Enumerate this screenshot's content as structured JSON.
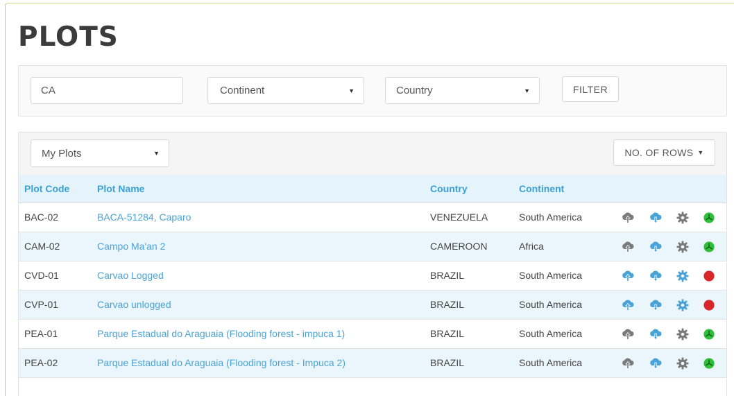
{
  "page": {
    "title": "PLOTS"
  },
  "filters": {
    "search_value": "CA",
    "continent_label": "Continent",
    "country_label": "Country",
    "filter_button": "FILTER"
  },
  "table": {
    "scope_select": "My Plots",
    "rows_button": "NO. OF ROWS",
    "columns": {
      "code": "Plot Code",
      "name": "Plot Name",
      "country": "Country",
      "continent": "Continent"
    },
    "rows": [
      {
        "code": "BAC-02",
        "name": "BACA-51284, Caparo",
        "country": "VENEZUELA",
        "continent": "South America",
        "upload": "inactive",
        "download": "active",
        "settings": "inactive",
        "status": "green"
      },
      {
        "code": "CAM-02",
        "name": "Campo Ma'an 2",
        "country": "CAMEROON",
        "continent": "Africa",
        "upload": "inactive",
        "download": "active",
        "settings": "inactive",
        "status": "green"
      },
      {
        "code": "CVD-01",
        "name": "Carvao Logged",
        "country": "BRAZIL",
        "continent": "South America",
        "upload": "active",
        "download": "active",
        "settings": "active",
        "status": "red"
      },
      {
        "code": "CVP-01",
        "name": "Carvao unlogged",
        "country": "BRAZIL",
        "continent": "South America",
        "upload": "active",
        "download": "active",
        "settings": "active",
        "status": "red"
      },
      {
        "code": "PEA-01",
        "name": "Parque Estadual do Araguaia (Flooding forest - impuca 1)",
        "country": "BRAZIL",
        "continent": "South America",
        "upload": "inactive",
        "download": "active",
        "settings": "inactive",
        "status": "green"
      },
      {
        "code": "PEA-02",
        "name": "Parque Estadual do Araguaia (Flooding forest - Impuca 2)",
        "country": "BRAZIL",
        "continent": "South America",
        "upload": "inactive",
        "download": "active",
        "settings": "inactive",
        "status": "green"
      }
    ]
  },
  "colors": {
    "accent_blue": "#4aa3d6",
    "icon_gray": "#7a7a7a",
    "status_green": "#2fbf3a",
    "status_red": "#d9262b",
    "header_bg": "#e5f3fb",
    "row_alt_bg": "#eaf5fc"
  },
  "icons": {
    "upload": "cloud-upload-icon",
    "download": "cloud-download-icon",
    "settings": "gear-icon",
    "status_ok": "status-ok-icon",
    "status_error": "status-error-icon"
  }
}
